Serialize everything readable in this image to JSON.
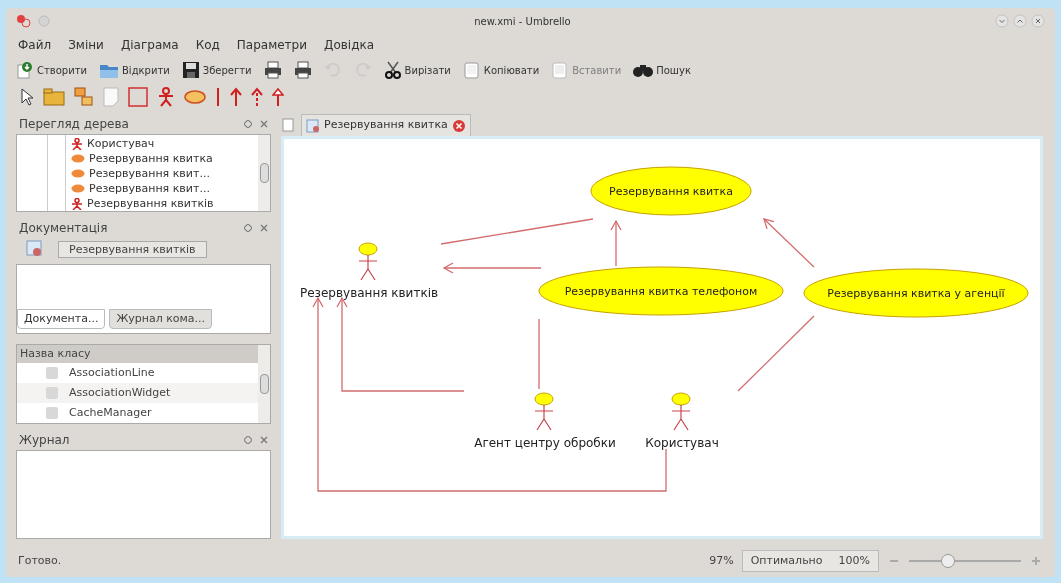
{
  "window": {
    "title": "new.xmi - Umbrello"
  },
  "menu": [
    "Файл",
    "Зміни",
    "Діаграма",
    "Код",
    "Параметри",
    "Довідка"
  ],
  "toolbar": [
    {
      "kind": "new",
      "label": "Створити",
      "disabled": false
    },
    {
      "kind": "open",
      "label": "Відкрити",
      "disabled": false
    },
    {
      "kind": "save",
      "label": "Зберегти",
      "disabled": false
    },
    {
      "kind": "print",
      "disabled": false
    },
    {
      "kind": "print",
      "disabled": false
    },
    {
      "kind": "undo",
      "disabled": true
    },
    {
      "kind": "redo",
      "disabled": true
    },
    {
      "kind": "cut",
      "label": "Вирізати",
      "disabled": false
    },
    {
      "kind": "copy",
      "label": "Копіювати",
      "disabled": false
    },
    {
      "kind": "paste",
      "label": "Вставити",
      "disabled": true
    },
    {
      "kind": "find",
      "label": "Пошук",
      "disabled": false
    }
  ],
  "tree_view": {
    "title": "Перегляд дерева",
    "items": [
      {
        "kind": "actor",
        "label": "Користувач"
      },
      {
        "kind": "usecase",
        "label": "Резервування квитка"
      },
      {
        "kind": "usecase",
        "label": "Резервування квит..."
      },
      {
        "kind": "usecase",
        "label": "Резервування квит..."
      },
      {
        "kind": "actor",
        "label": "Резервування квитків"
      }
    ]
  },
  "documentation": {
    "title": "Документація",
    "name_button": "Резервування квитків",
    "tabs": [
      {
        "label": "Документа...",
        "selected": true
      },
      {
        "label": "Журнал кома...",
        "selected": false
      }
    ]
  },
  "classes": {
    "column": "Назва класу",
    "items": [
      "AssociationLine",
      "AssociationWidget",
      "CacheManager"
    ]
  },
  "log": {
    "title": "Журнал"
  },
  "diagram_tab": {
    "label": "Резервування квитка"
  },
  "diagram": {
    "use_cases": [
      "Резервування квитка",
      "Резервування квитка телефоном",
      "Резервування квитка у агенції"
    ],
    "actors": [
      "Резервування квитків",
      "Агент центру обробки",
      "Користувач"
    ]
  },
  "status_bar": {
    "text": "Готово.",
    "zoom": "97%",
    "buttons": [
      "Оптимально",
      "100%"
    ],
    "zoom_slider": {
      "level": 0.35
    }
  }
}
